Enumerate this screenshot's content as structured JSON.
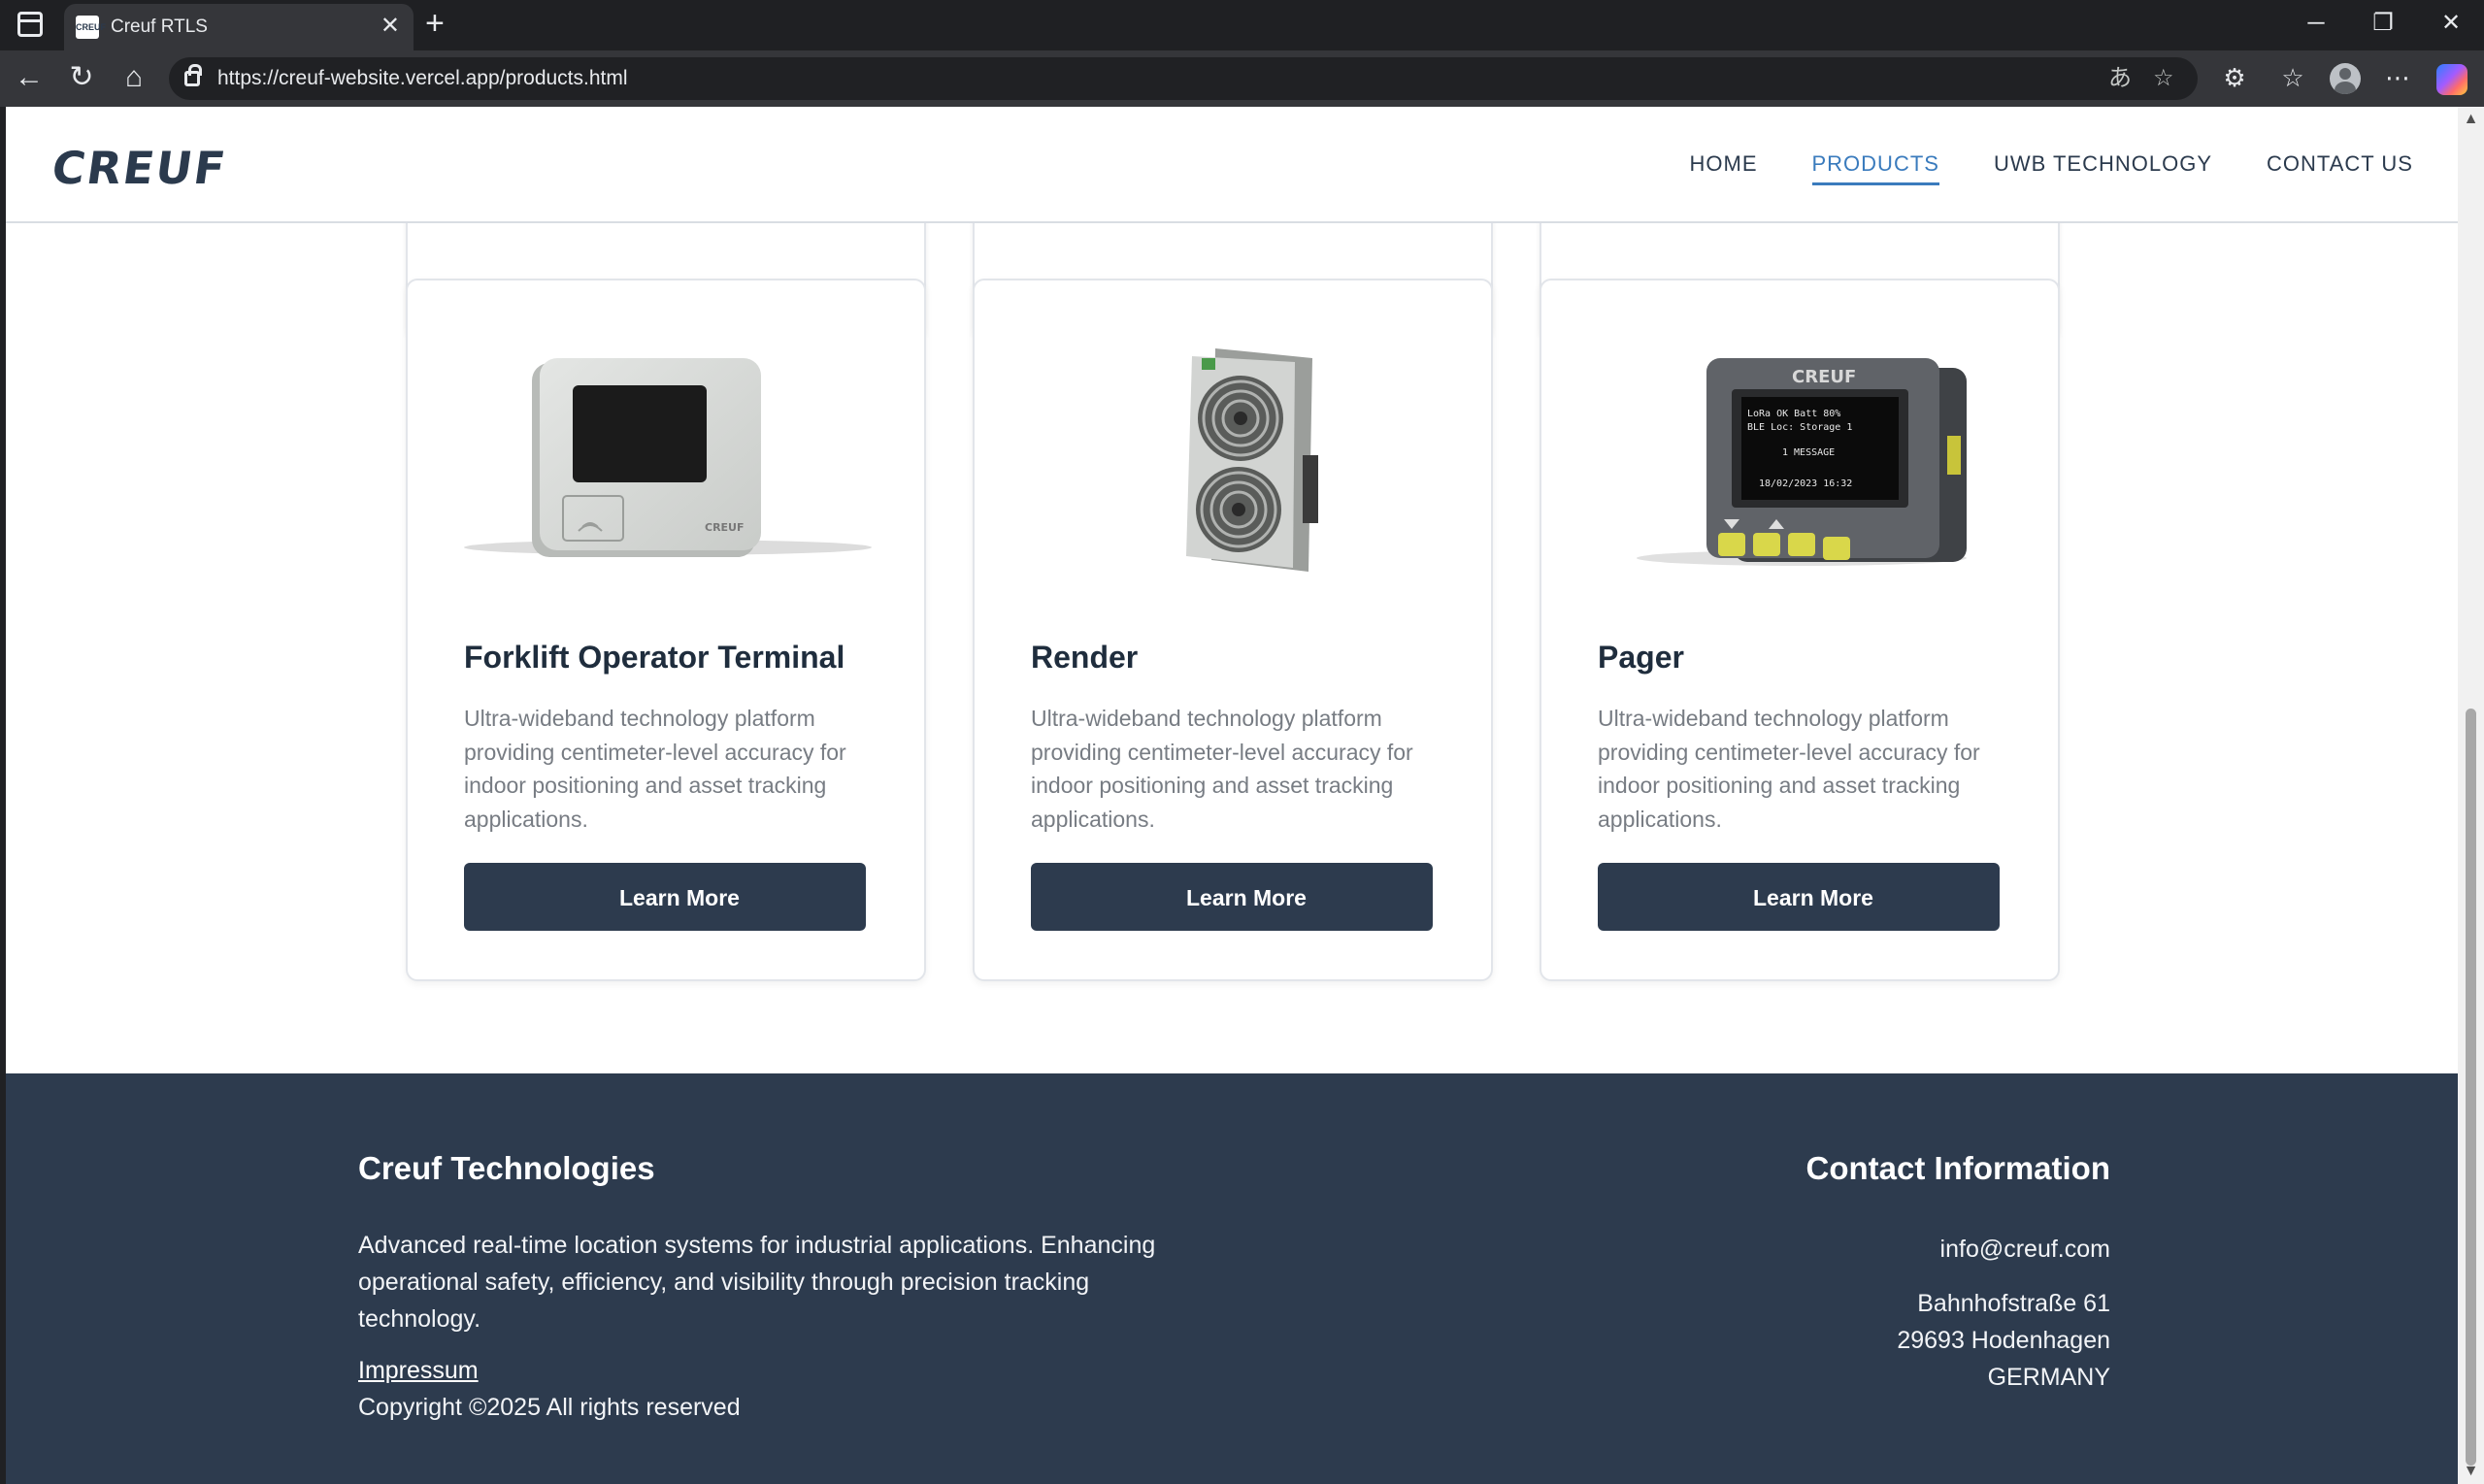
{
  "browser": {
    "tab_title": "Creuf RTLS",
    "favicon_text": "CREUF",
    "url": "https://creuf-website.vercel.app/products.html"
  },
  "site": {
    "logo": "CREUF",
    "nav": [
      {
        "label": "HOME",
        "active": false
      },
      {
        "label": "PRODUCTS",
        "active": true
      },
      {
        "label": "UWB TECHNOLOGY",
        "active": false
      },
      {
        "label": "CONTACT US",
        "active": false
      }
    ]
  },
  "products": [
    {
      "title": "Forklift Operator Terminal",
      "description": "Ultra-wideband technology platform providing centimeter-level accuracy for indoor positioning and asset tracking applications.",
      "button": "Learn More",
      "image_text": "CREUF"
    },
    {
      "title": "Render",
      "description": "Ultra-wideband technology platform providing centimeter-level accuracy for indoor positioning and asset tracking applications.",
      "button": "Learn More"
    },
    {
      "title": "Pager",
      "description": "Ultra-wideband technology platform providing centimeter-level accuracy for indoor positioning and asset tracking applications.",
      "button": "Learn More",
      "image_text": "CREUF",
      "screen_lines": [
        "LoRa OK   Batt 80%",
        "BLE Loc: Storage 1",
        "1 MESSAGE",
        "18/02/2023 16:32"
      ]
    }
  ],
  "footer": {
    "company": "Creuf Technologies",
    "description": "Advanced real-time location systems for industrial applications. Enhancing operational safety, efficiency, and visibility through precision tracking technology.",
    "impressum": "Impressum",
    "copyright": "Copyright ©2025 All rights reserved",
    "contact_title": "Contact Information",
    "email": "info@creuf.com",
    "address_street": "Bahnhofstraße 61",
    "address_city": "29693 Hodenhagen",
    "address_country": "GERMANY"
  },
  "colors": {
    "primary": "#2d3b4e",
    "accent": "#3a7bbd",
    "text_muted": "#777c83"
  }
}
